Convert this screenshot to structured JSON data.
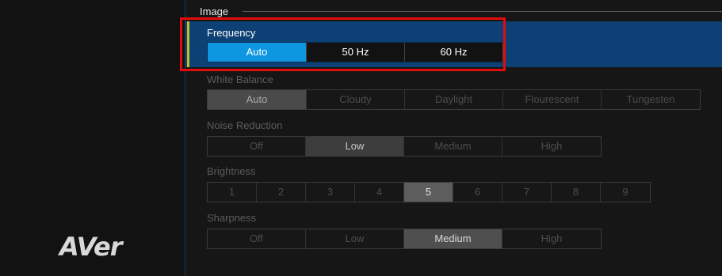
{
  "logo": {
    "text": "AVer"
  },
  "section": {
    "title": "Image"
  },
  "frequency": {
    "label": "Frequency",
    "options": [
      "Auto",
      "50 Hz",
      "60 Hz"
    ],
    "selected": "Auto"
  },
  "white_balance": {
    "label": "White Balance",
    "options": [
      "Auto",
      "Cloudy",
      "Daylight",
      "Flourescent",
      "Tungesten"
    ],
    "selected": "Auto"
  },
  "noise_reduction": {
    "label": "Noise Reduction",
    "options": [
      "Off",
      "Low",
      "Medium",
      "High"
    ],
    "selected": "Low"
  },
  "brightness": {
    "label": "Brightness",
    "options": [
      "1",
      "2",
      "3",
      "4",
      "5",
      "6",
      "7",
      "8",
      "9"
    ],
    "selected": "5"
  },
  "sharpness": {
    "label": "Sharpness",
    "options": [
      "Off",
      "Low",
      "Medium",
      "High"
    ],
    "selected": "Medium"
  },
  "colors": {
    "selected_blue": "#0e96e0",
    "row_highlight": "#0d4074",
    "accent_bar": "#c4c11a",
    "callout_red": "#e30b0b"
  }
}
